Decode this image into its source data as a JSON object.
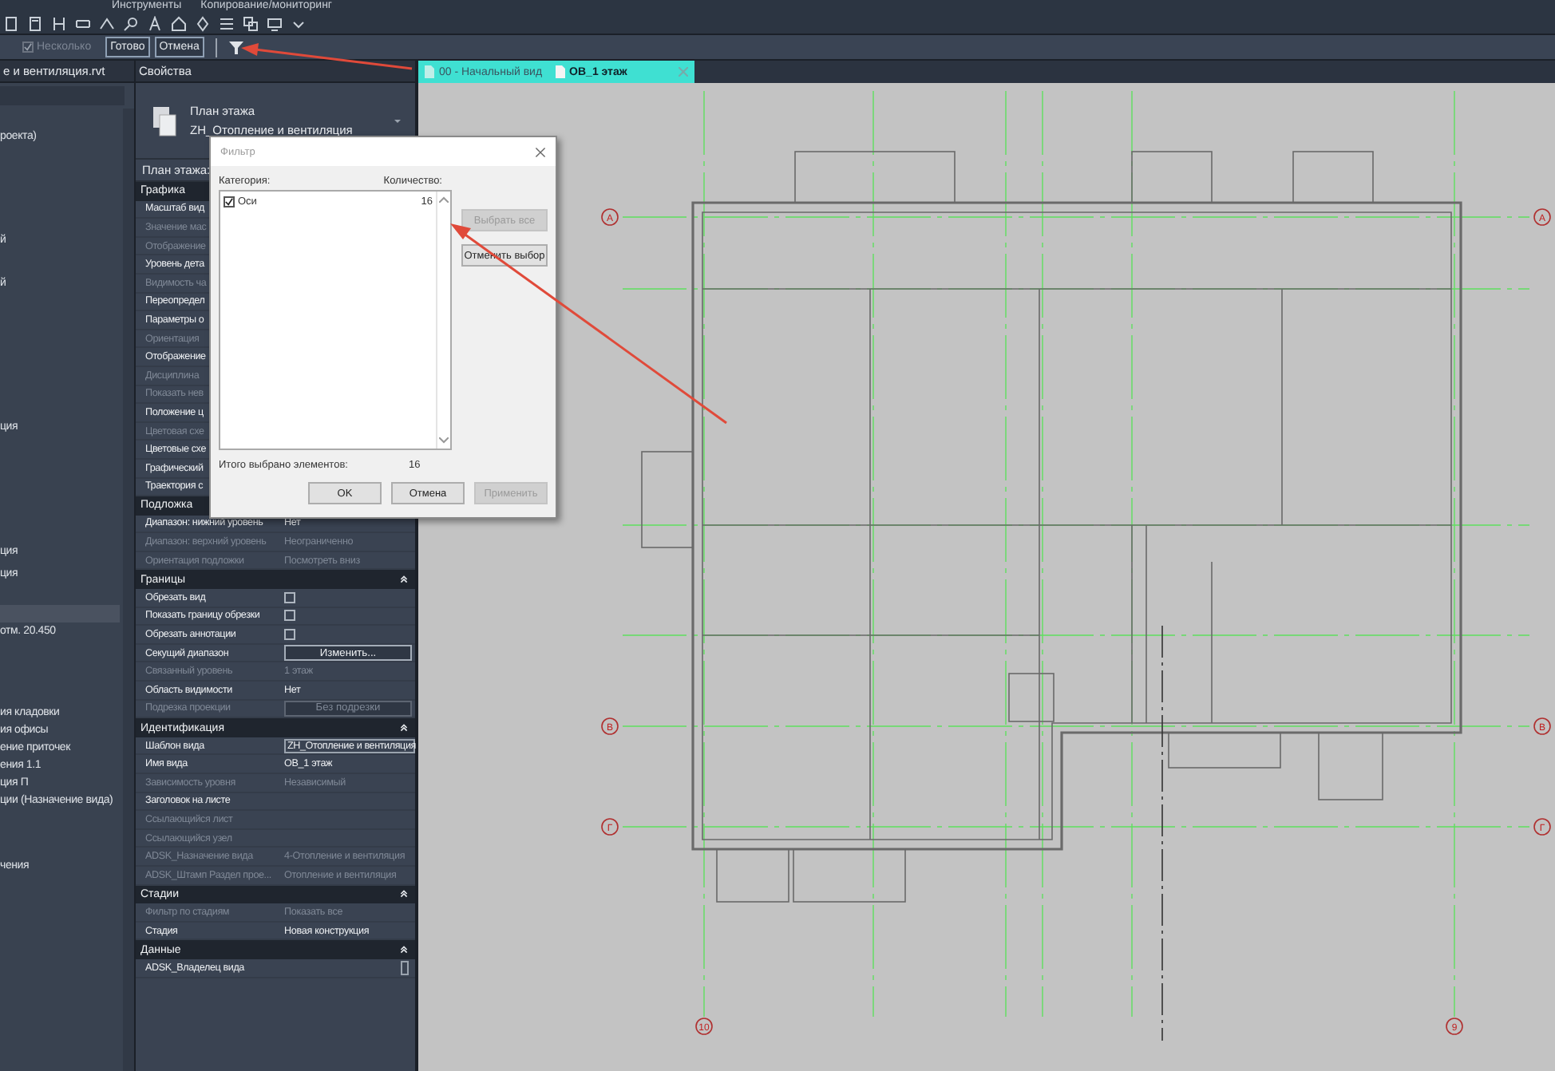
{
  "ribbon": {
    "panel_labels": [
      "Инструменты",
      "Копирование/мониторинг"
    ]
  },
  "options_bar": {
    "multiple": {
      "label": "Несколько",
      "checked": true,
      "disabled": true
    },
    "buttons": [
      {
        "label": "Готово"
      },
      {
        "label": "Отмена"
      }
    ]
  },
  "project_browser": {
    "title": "е и вентиляция.rvt",
    "items": [
      {
        "label": "роекта)"
      },
      {
        "label": "й"
      },
      {
        "label": "й"
      },
      {
        "label": "ция"
      },
      {
        "label": "ция"
      },
      {
        "label": "ция"
      },
      {
        "label": "отм. 20.450"
      },
      {
        "label": "ия кладовки"
      },
      {
        "label": "ия офисы"
      },
      {
        "label": "ение приточек"
      },
      {
        "label": "ения 1.1"
      },
      {
        "label": "ция П"
      },
      {
        "label": "ции (Назначение вида)"
      },
      {
        "label": "чения"
      }
    ]
  },
  "properties": {
    "title": "Свойства",
    "type_name": "План этажа",
    "type_value": "ZH_Отопление и вентиляция",
    "instance_label": "План этажа:",
    "sections": [
      {
        "title": "Графика",
        "collapse_icon": false,
        "rows": [
          {
            "kind": "text",
            "label": "Масштаб вид",
            "disabled": false
          },
          {
            "kind": "text",
            "label": "Значение мас",
            "disabled": true
          },
          {
            "kind": "text",
            "label": "Отображение",
            "disabled": true
          },
          {
            "kind": "text",
            "label": "Уровень дета",
            "disabled": false
          },
          {
            "kind": "text",
            "label": "Видимость ча",
            "disabled": true
          },
          {
            "kind": "text",
            "label": "Переопредел",
            "disabled": false
          },
          {
            "kind": "text",
            "label": "Параметры о",
            "disabled": false
          },
          {
            "kind": "text",
            "label": "Ориентация",
            "disabled": true
          },
          {
            "kind": "text",
            "label": "Отображение",
            "disabled": false
          },
          {
            "kind": "text",
            "label": "Дисциплина",
            "disabled": true
          },
          {
            "kind": "text",
            "label": "Показать нев",
            "disabled": true
          },
          {
            "kind": "text",
            "label": "Положение ц",
            "disabled": false
          },
          {
            "kind": "text",
            "label": "Цветовая схе",
            "disabled": true
          },
          {
            "kind": "text",
            "label": "Цветовые схе",
            "disabled": false
          },
          {
            "kind": "text",
            "label": "Графический",
            "disabled": false
          },
          {
            "kind": "text",
            "label": "Траектория с",
            "disabled": false
          }
        ]
      },
      {
        "title": "Подложка",
        "collapse_icon": false,
        "rows": [
          {
            "kind": "text",
            "label": "Диапазон: нижний уровень",
            "value": "Нет",
            "disabled": false
          },
          {
            "kind": "text",
            "label": "Диапазон: верхний уровень",
            "value": "Неограниченно",
            "disabled": true
          },
          {
            "kind": "text",
            "label": "Ориентация подложки",
            "value": "Посмотреть вниз",
            "disabled": true
          }
        ]
      },
      {
        "title": "Границы",
        "collapse_icon": true,
        "rows": [
          {
            "kind": "checkbox",
            "label": "Обрезать вид",
            "checked": false,
            "disabled": false
          },
          {
            "kind": "checkbox",
            "label": "Показать границу обрезки",
            "checked": false,
            "disabled": false
          },
          {
            "kind": "checkbox",
            "label": "Обрезать аннотации",
            "checked": false,
            "disabled": false
          },
          {
            "kind": "button",
            "label": "Секущий диапазон",
            "value": "Изменить...",
            "disabled": false
          },
          {
            "kind": "text",
            "label": "Связанный уровень",
            "value": "1 этаж",
            "disabled": true
          },
          {
            "kind": "text",
            "label": "Область видимости",
            "value": "Нет",
            "disabled": false
          },
          {
            "kind": "button",
            "label": "Подрезка проекции",
            "value": "Без подрезки",
            "disabled": true
          }
        ]
      },
      {
        "title": "Идентификация",
        "collapse_icon": true,
        "rows": [
          {
            "kind": "field",
            "label": "Шаблон вида",
            "value": "ZH_Отопление и вентиляция",
            "disabled": false
          },
          {
            "kind": "text",
            "label": "Имя вида",
            "value": "ОВ_1 этаж",
            "disabled": false
          },
          {
            "kind": "text",
            "label": "Зависимость уровня",
            "value": "Независимый",
            "disabled": true
          },
          {
            "kind": "text",
            "label": "Заголовок на листе",
            "disabled": false
          },
          {
            "kind": "text",
            "label": "Ссылающийся лист",
            "disabled": true
          },
          {
            "kind": "text",
            "label": "Ссылающийся узел",
            "disabled": true
          },
          {
            "kind": "text",
            "label": "ADSK_Назначение вида",
            "value": "4-Отопление и вентиляция",
            "disabled": true
          },
          {
            "kind": "text",
            "label": "ADSK_Штамп Раздел прое...",
            "value": "Отопление и вентиляция",
            "disabled": true
          }
        ]
      },
      {
        "title": "Стадии",
        "collapse_icon": true,
        "rows": [
          {
            "kind": "text",
            "label": "Фильтр по стадиям",
            "value": "Показать все",
            "disabled": true
          },
          {
            "kind": "text",
            "label": "Стадия",
            "value": "Новая конструкция",
            "disabled": false
          }
        ]
      },
      {
        "title": "Данные",
        "collapse_icon": true,
        "rows": [
          {
            "kind": "edit",
            "label": "ADSK_Владелец вида",
            "disabled": false
          }
        ]
      }
    ]
  },
  "view_tabs": [
    {
      "label": "00 - Начальный вид",
      "selected": false
    },
    {
      "label": "ОВ_1 этаж",
      "selected": true
    }
  ],
  "plan": {
    "axis_markers": [
      {
        "label": "А"
      },
      {
        "label": "В"
      },
      {
        "label": "Г"
      },
      {
        "label": "А"
      },
      {
        "label": "В"
      },
      {
        "label": "Г"
      },
      {
        "label": "10"
      },
      {
        "label": "9"
      }
    ]
  },
  "filter_dialog": {
    "title": "Фильтр",
    "category_header": "Категория:",
    "count_header": "Количество:",
    "categories": [
      {
        "label": "Оси",
        "count": "16",
        "checked": true
      }
    ],
    "side_buttons": [
      {
        "label": "Выбрать все",
        "disabled": true
      },
      {
        "label": "Отменить выбор",
        "disabled": false
      }
    ],
    "total_label": "Итого выбрано элементов:",
    "total_value": "16",
    "buttons": [
      {
        "label": "OK",
        "disabled": false
      },
      {
        "label": "Отмена",
        "disabled": false
      },
      {
        "label": "Применить",
        "disabled": true
      }
    ]
  }
}
